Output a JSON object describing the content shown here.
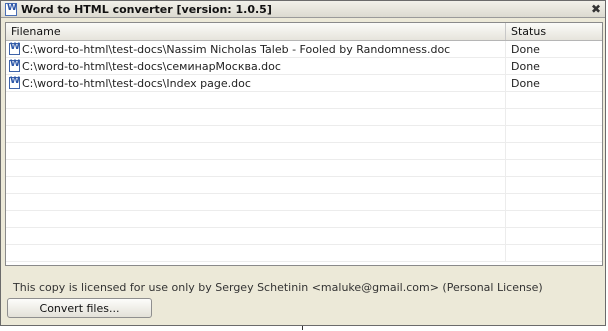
{
  "window": {
    "title": "Word to HTML converter [version: 1.0.5]",
    "close_symbol": "✖"
  },
  "grid": {
    "columns": {
      "filename": "Filename",
      "status": "Status"
    },
    "rows": [
      {
        "filename": "C:\\word-to-html\\test-docs\\Nassim Nicholas Taleb - Fooled by Randomness.doc",
        "status": "Done"
      },
      {
        "filename": "C:\\word-to-html\\test-docs\\семинарМосква.doc",
        "status": "Done"
      },
      {
        "filename": "C:\\word-to-html\\test-docs\\Index page.doc",
        "status": "Done"
      }
    ]
  },
  "license_text": "This copy is licensed for use only by Sergey Schetinin <maluke@gmail.com> (Personal License)",
  "convert_button": "Convert files..."
}
